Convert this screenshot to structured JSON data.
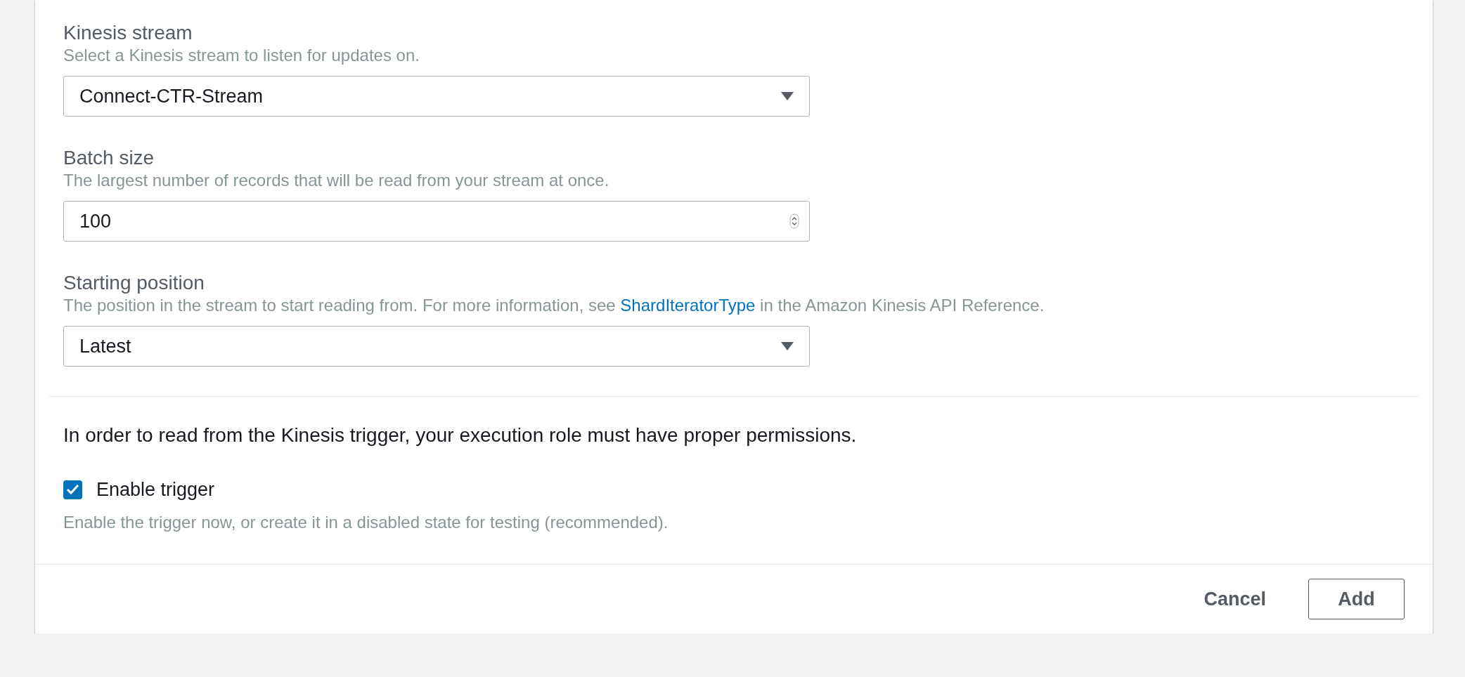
{
  "fields": [
    {
      "kind": "select",
      "label": "Kinesis stream",
      "description": "Select a Kinesis stream to listen for updates on.",
      "value": "Connect-CTR-Stream"
    },
    {
      "kind": "number",
      "label": "Batch size",
      "description": "The largest number of records that will be read from your stream at once.",
      "value": "100"
    },
    {
      "kind": "select",
      "label": "Starting position",
      "description": "The position in the stream to start reading from. For more information, see ",
      "link": "ShardIteratorType",
      "description_after": " in the Amazon Kinesis API Reference.",
      "value": "Latest"
    }
  ],
  "notice": "In order to read from the Kinesis trigger, your execution role must have proper permissions.",
  "trigger": {
    "label": "Enable trigger",
    "checked": true,
    "help": "Enable the trigger now, or create it in a disabled state for testing (recommended)."
  },
  "buttons": [
    {
      "kind": "link",
      "label": "Cancel"
    },
    {
      "kind": "outline",
      "label": "Add"
    }
  ]
}
